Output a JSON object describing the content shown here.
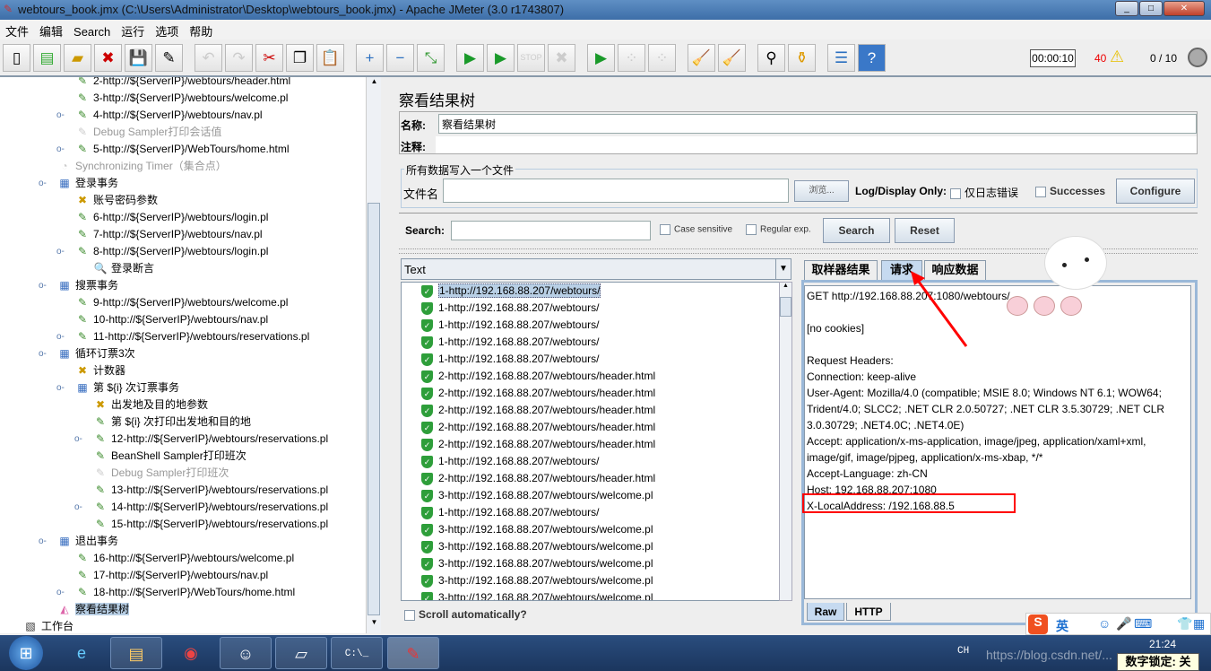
{
  "window": {
    "title": "webtours_book.jmx (C:\\Users\\Administrator\\Desktop\\webtours_book.jmx) - Apache JMeter (3.0 r1743807)"
  },
  "menu": [
    "文件",
    "编辑",
    "Search",
    "运行",
    "选项",
    "帮助"
  ],
  "status": {
    "timer": "00:00:10",
    "errors": "40",
    "threads": "0 / 10"
  },
  "tree": [
    {
      "label": "2-http://${ServerIP}/webtours/header.html",
      "level": 2,
      "icon": "sampler-icon"
    },
    {
      "label": "3-http://${ServerIP}/webtours/welcome.pl",
      "level": 2,
      "icon": "sampler-icon"
    },
    {
      "label": "4-http://${ServerIP}/webtours/nav.pl",
      "level": 2,
      "icon": "sampler-icon",
      "handle": true
    },
    {
      "label": "Debug Sampler打印会话值",
      "level": 2,
      "icon": "sampler-icon",
      "disabled": true
    },
    {
      "label": "5-http://${ServerIP}/WebTours/home.html",
      "level": 2,
      "icon": "sampler-icon",
      "handle": true
    },
    {
      "label": "Synchronizing Timer（集合点）",
      "level": 1,
      "icon": "timer-icon",
      "disabled": true
    },
    {
      "label": "登录事务",
      "level": 1,
      "icon": "transaction-icon",
      "handle": true
    },
    {
      "label": "账号密码参数",
      "level": 2,
      "icon": "config-icon"
    },
    {
      "label": "6-http://${ServerIP}/webtours/login.pl",
      "level": 2,
      "icon": "sampler-icon"
    },
    {
      "label": "7-http://${ServerIP}/webtours/nav.pl",
      "level": 2,
      "icon": "sampler-icon"
    },
    {
      "label": "8-http://${ServerIP}/webtours/login.pl",
      "level": 2,
      "icon": "sampler-icon",
      "handle": true
    },
    {
      "label": "登录断言",
      "level": 3,
      "icon": "assertion-icon"
    },
    {
      "label": "搜票事务",
      "level": 1,
      "icon": "transaction-icon",
      "handle": true
    },
    {
      "label": "9-http://${ServerIP}/webtours/welcome.pl",
      "level": 2,
      "icon": "sampler-icon"
    },
    {
      "label": "10-http://${ServerIP}/webtours/nav.pl",
      "level": 2,
      "icon": "sampler-icon"
    },
    {
      "label": "11-http://${ServerIP}/webtours/reservations.pl",
      "level": 2,
      "icon": "sampler-icon",
      "handle": true
    },
    {
      "label": "循环订票3次",
      "level": 1,
      "icon": "transaction-icon",
      "handle": true
    },
    {
      "label": "计数器",
      "level": 2,
      "icon": "config-icon"
    },
    {
      "label": "第 ${i} 次订票事务",
      "level": 2,
      "icon": "transaction-icon",
      "handle": true
    },
    {
      "label": "出发地及目的地参数",
      "level": 3,
      "icon": "config-icon"
    },
    {
      "label": "第 ${i} 次打印出发地和目的地",
      "level": 3,
      "icon": "sampler-icon"
    },
    {
      "label": "12-http://${ServerIP}/webtours/reservations.pl",
      "level": 3,
      "icon": "sampler-icon",
      "handle": true
    },
    {
      "label": "BeanShell Sampler打印班次",
      "level": 3,
      "icon": "sampler-icon"
    },
    {
      "label": "Debug Sampler打印班次",
      "level": 3,
      "icon": "sampler-icon",
      "disabled": true
    },
    {
      "label": "13-http://${ServerIP}/webtours/reservations.pl",
      "level": 3,
      "icon": "sampler-icon"
    },
    {
      "label": "14-http://${ServerIP}/webtours/reservations.pl",
      "level": 3,
      "icon": "sampler-icon",
      "handle": true
    },
    {
      "label": "15-http://${ServerIP}/webtours/reservations.pl",
      "level": 3,
      "icon": "sampler-icon"
    },
    {
      "label": "退出事务",
      "level": 1,
      "icon": "transaction-icon",
      "handle": true
    },
    {
      "label": "16-http://${ServerIP}/webtours/welcome.pl",
      "level": 2,
      "icon": "sampler-icon"
    },
    {
      "label": "17-http://${ServerIP}/webtours/nav.pl",
      "level": 2,
      "icon": "sampler-icon"
    },
    {
      "label": "18-http://${ServerIP}/WebTours/home.html",
      "level": 2,
      "icon": "sampler-icon",
      "handle": true
    },
    {
      "label": "察看结果树",
      "level": 1,
      "icon": "listener-icon",
      "selected": true
    },
    {
      "label": "工作台",
      "level": 0,
      "icon": "workbench-icon"
    }
  ],
  "panel": {
    "title": "察看结果树",
    "name_label": "名称:",
    "name_value": "察看结果树",
    "comment_label": "注释:",
    "file_group": "所有数据写入一个文件",
    "file_label": "文件名",
    "browse": "浏览...",
    "log_display": "Log/Display Only:",
    "errors_only": "仅日志错误",
    "successes": "Successes",
    "configure": "Configure",
    "search_label": "Search:",
    "case_sensitive": "Case sensitive",
    "regex": "Regular exp.",
    "search_btn": "Search",
    "reset_btn": "Reset",
    "renderer": "Text",
    "scroll_auto": "Scroll automatically?"
  },
  "results": [
    "1-http://192.168.88.207/webtours/",
    "1-http://192.168.88.207/webtours/",
    "1-http://192.168.88.207/webtours/",
    "1-http://192.168.88.207/webtours/",
    "1-http://192.168.88.207/webtours/",
    "2-http://192.168.88.207/webtours/header.html",
    "2-http://192.168.88.207/webtours/header.html",
    "2-http://192.168.88.207/webtours/header.html",
    "2-http://192.168.88.207/webtours/header.html",
    "2-http://192.168.88.207/webtours/header.html",
    "1-http://192.168.88.207/webtours/",
    "2-http://192.168.88.207/webtours/header.html",
    "3-http://192.168.88.207/webtours/welcome.pl",
    "1-http://192.168.88.207/webtours/",
    "3-http://192.168.88.207/webtours/welcome.pl",
    "3-http://192.168.88.207/webtours/welcome.pl",
    "3-http://192.168.88.207/webtours/welcome.pl",
    "3-http://192.168.88.207/webtours/welcome.pl",
    "3-http://192.168.88.207/webtours/welcome.pl"
  ],
  "tabs": [
    "取样器结果",
    "请求",
    "响应数据"
  ],
  "active_tab": "请求",
  "bottom_tabs": [
    "Raw",
    "HTTP"
  ],
  "request_lines": [
    "GET http://192.168.88.207:1080/webtours/",
    "",
    "[no cookies]",
    "",
    "Request Headers:",
    "Connection: keep-alive",
    "User-Agent: Mozilla/4.0 (compatible; MSIE 8.0; Windows NT 6.1; WOW64;",
    "Trident/4.0; SLCC2; .NET CLR 2.0.50727; .NET CLR 3.5.30729; .NET CLR",
    "3.0.30729; .NET4.0C; .NET4.0E)",
    "Accept: application/x-ms-application, image/jpeg, application/xaml+xml,",
    "image/gif, image/pjpeg, application/x-ms-xbap, */*",
    "Accept-Language: zh-CN",
    "Host: 192.168.88.207:1080",
    "X-LocalAddress: /192.168.88.5"
  ],
  "taskbar": {
    "lang": "CH",
    "ime": "英",
    "clock": "21:24",
    "numlock": "数字锁定: 关",
    "watermark": "https://blog.csdn.net/..."
  },
  "colors": {
    "highlight": "#ff0000",
    "selection": "#b8cfe5",
    "success": "#2e9e3a"
  }
}
